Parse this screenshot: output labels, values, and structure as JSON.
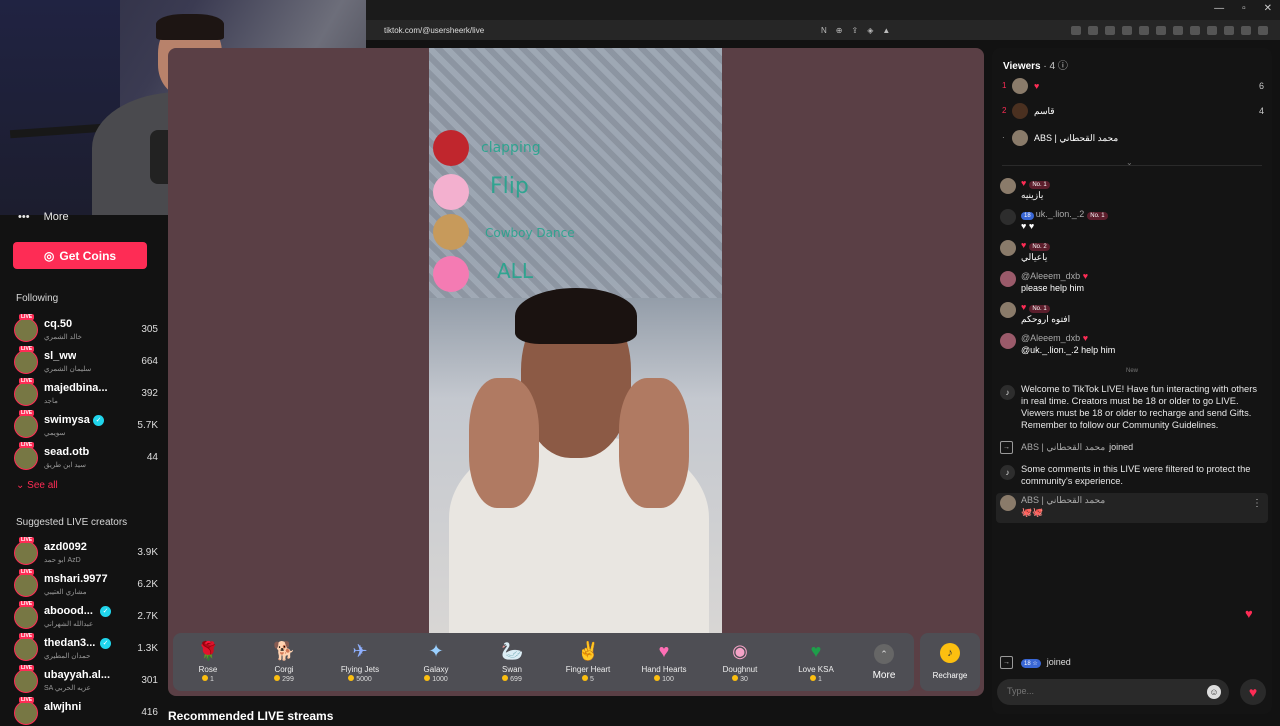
{
  "browser": {
    "url": "tiktok.com/@usersheerk/live"
  },
  "sidebar": {
    "more_label": "More",
    "get_coins": "Get Coins",
    "following_title": "Following",
    "following": [
      {
        "name": "cq.50",
        "sub": "خالد الشمري",
        "count": "305"
      },
      {
        "name": "sl_ww",
        "sub": "سليمان الشمري",
        "count": "664"
      },
      {
        "name": "majedbina...",
        "sub": "ماجد",
        "count": "392"
      },
      {
        "name": "swimysa",
        "sub": "سويمي",
        "count": "5.7K",
        "verified": true
      },
      {
        "name": "sead.otb",
        "sub": "سيد ابن طريق",
        "count": "44"
      }
    ],
    "see_all": "See all",
    "suggested_title": "Suggested LIVE creators",
    "suggested": [
      {
        "name": "azd0092",
        "sub": "ابو حمد AzD",
        "count": "3.9K"
      },
      {
        "name": "mshari.9977",
        "sub": "مشاري العتيبي",
        "count": "6.2K"
      },
      {
        "name": "aboood...",
        "sub": "عبدالله الشهراني",
        "count": "2.7K",
        "verified": true
      },
      {
        "name": "thedan3...",
        "sub": "حمدان المطيري",
        "count": "1.3K",
        "verified": true
      },
      {
        "name": "ubayyah.al...",
        "sub": "SA عزيه الحربي",
        "count": "301"
      },
      {
        "name": "alwjhni",
        "sub": "",
        "count": "416"
      }
    ]
  },
  "video_overlay": [
    {
      "label": "clapping"
    },
    {
      "label": "Flip"
    },
    {
      "label": "Cowboy Dance"
    },
    {
      "label": "ALL"
    }
  ],
  "gifts": [
    {
      "name": "Rose",
      "price": "1",
      "icon": "🌹"
    },
    {
      "name": "Corgi",
      "price": "299",
      "icon": "🐕"
    },
    {
      "name": "Flying Jets",
      "price": "5000",
      "icon": "✈"
    },
    {
      "name": "Galaxy",
      "price": "1000",
      "icon": "✦"
    },
    {
      "name": "Swan",
      "price": "699",
      "icon": "🦢"
    },
    {
      "name": "Finger Heart",
      "price": "5",
      "icon": "✌"
    },
    {
      "name": "Hand Hearts",
      "price": "100",
      "icon": "♥"
    },
    {
      "name": "Doughnut",
      "price": "30",
      "icon": "◉"
    },
    {
      "name": "Love KSA",
      "price": "1",
      "icon": "♥"
    }
  ],
  "more_label": "More",
  "recharge_label": "Recharge",
  "recommended_title": "Recommended LIVE streams",
  "chat": {
    "viewers_label": "Viewers",
    "viewers_count": "· 4",
    "viewers": [
      {
        "rank": "1",
        "name": "♥",
        "score": "6"
      },
      {
        "rank": "2",
        "name": "قاسم",
        "score": "4"
      },
      {
        "rank": "·",
        "name": "ABS | محمد القحطاني",
        "score": ""
      }
    ],
    "messages": [
      {
        "name": "♥",
        "badge": "No. 1",
        "text": "يازينيه"
      },
      {
        "name": "uk._.lion._.2",
        "level": "18",
        "badge": "No. 1",
        "text": "♥ ♥"
      },
      {
        "name": "♥",
        "badge": "No. 2",
        "text": "ياعيالي"
      },
      {
        "name": "@Aleeem_dxb",
        "text": "please help him"
      },
      {
        "name": "♥",
        "badge": "No. 1",
        "text": "افتوه اروحكم"
      },
      {
        "name": "@Aleeem_dxb",
        "text": "@uk._.lion._.2 help him"
      }
    ],
    "new_label": "New",
    "welcome": "Welcome to TikTok LIVE! Have fun interacting with others in real time. Creators must be 18 or older to go LIVE. Viewers must be 18 or older to recharge and send Gifts. Remember to follow our Community Guidelines.",
    "join1_name": "ABS | محمد القحطاني",
    "joined": "joined",
    "filtered": "Some comments in this LIVE were filtered to protect the community's experience.",
    "last_name": "ABS | محمد القحطاني",
    "last_text": "🐙🐙",
    "join2_name": "18 ☆",
    "input_placeholder": "Type..."
  }
}
